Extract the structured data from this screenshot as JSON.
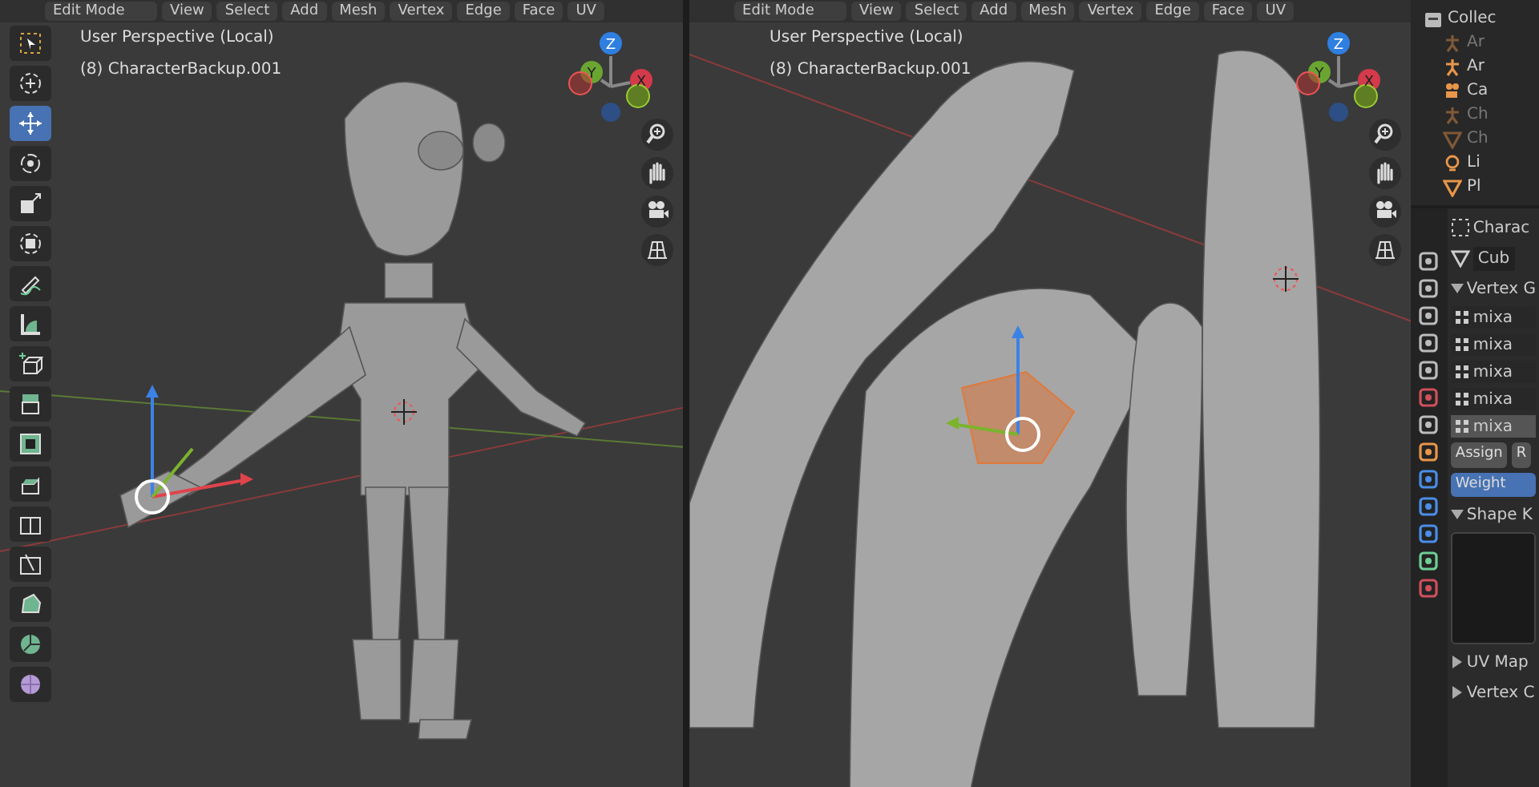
{
  "viewports": [
    {
      "header": {
        "mode": "Edit Mode",
        "menus": [
          "View",
          "Select",
          "Add",
          "Mesh",
          "Vertex",
          "Edge",
          "Face",
          "UV"
        ]
      },
      "overlay": [
        "User Perspective (Local)",
        "(8) CharacterBackup.001"
      ],
      "axes": [
        "X",
        "Y",
        "Z"
      ],
      "kind": "character",
      "toolbar": [
        {
          "kind": "select",
          "selected": false
        },
        {
          "kind": "cursor",
          "selected": false
        },
        {
          "kind": "move",
          "selected": true
        },
        {
          "kind": "rotate",
          "selected": false
        },
        {
          "kind": "scale",
          "selected": false
        },
        {
          "kind": "transform",
          "selected": false
        },
        {
          "kind": "annotate",
          "selected": false
        },
        {
          "kind": "measure",
          "selected": false
        },
        {
          "kind": "add",
          "selected": false
        },
        {
          "kind": "extrude",
          "selected": false
        },
        {
          "kind": "inset",
          "selected": false
        },
        {
          "kind": "bevel",
          "selected": false
        },
        {
          "kind": "loopcut",
          "selected": false
        },
        {
          "kind": "knife",
          "selected": false
        },
        {
          "kind": "polybuild",
          "selected": false
        },
        {
          "kind": "spin",
          "selected": false
        },
        {
          "kind": "smooth",
          "selected": false
        }
      ]
    },
    {
      "header": {
        "mode": "Edit Mode",
        "menus": [
          "View",
          "Select",
          "Add",
          "Mesh",
          "Vertex",
          "Edge",
          "Face",
          "UV"
        ]
      },
      "overlay": [
        "User Perspective (Local)",
        "(8) CharacterBackup.001"
      ],
      "axes": [
        "X",
        "Y",
        "Z"
      ],
      "kind": "hand"
    }
  ],
  "outliner": {
    "collection": "Collec",
    "items": [
      {
        "kind": "armature",
        "label": "Ar",
        "dimmed": true
      },
      {
        "kind": "armature",
        "label": "Ar",
        "dimmed": false
      },
      {
        "kind": "camera",
        "label": "Ca",
        "dimmed": false
      },
      {
        "kind": "armature",
        "label": "Ch",
        "dimmed": true
      },
      {
        "kind": "mesh",
        "label": "Ch",
        "dimmed": true
      },
      {
        "kind": "light",
        "label": "Li",
        "dimmed": false
      },
      {
        "kind": "mesh",
        "label": "Pl",
        "dimmed": false
      }
    ]
  },
  "properties": {
    "tabs": [
      {
        "kind": "tool"
      },
      {
        "kind": "render"
      },
      {
        "kind": "output"
      },
      {
        "kind": "view"
      },
      {
        "kind": "scene"
      },
      {
        "kind": "world"
      },
      {
        "kind": "collection"
      },
      {
        "kind": "object"
      },
      {
        "kind": "modifier"
      },
      {
        "kind": "particles"
      },
      {
        "kind": "physics"
      },
      {
        "kind": "data"
      },
      {
        "kind": "material"
      }
    ],
    "object_name": "Charac",
    "mesh_name": "Cub",
    "vertex_groups": {
      "title": "Vertex G",
      "expanded": true,
      "groups": [
        {
          "label": "mixa",
          "selected": false
        },
        {
          "label": "mixa",
          "selected": false
        },
        {
          "label": "mixa",
          "selected": false
        },
        {
          "label": "mixa",
          "selected": false
        },
        {
          "label": "mixa",
          "selected": true
        }
      ],
      "buttons": [
        "Assign",
        "R"
      ],
      "weight": "Weight"
    },
    "panels": [
      {
        "title": "Shape K",
        "expanded": true
      },
      {
        "title": "UV Map",
        "expanded": false
      },
      {
        "title": "Vertex C",
        "expanded": false
      }
    ]
  }
}
